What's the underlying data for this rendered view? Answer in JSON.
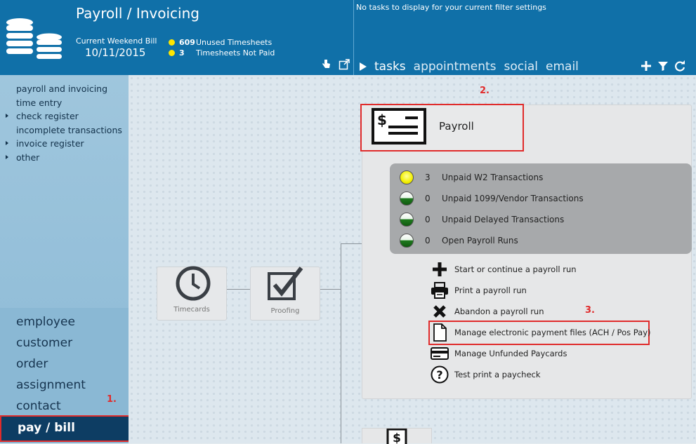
{
  "header": {
    "title": "Payroll / Invoicing",
    "bill_label": "Current Weekend Bill",
    "bill_date": "10/11/2015",
    "stats": [
      {
        "count": "609",
        "label": "Unused Timesheets"
      },
      {
        "count": "3",
        "label": "Timesheets Not Paid"
      }
    ],
    "no_tasks": "No tasks to display for your current filter settings",
    "tabs": [
      "tasks",
      "appointments",
      "social",
      "email"
    ]
  },
  "sidebar": {
    "links": [
      {
        "label": "payroll and invoicing"
      },
      {
        "label": "time entry"
      },
      {
        "label": "check register"
      },
      {
        "label": "incomplete transactions"
      },
      {
        "label": "invoice register"
      },
      {
        "label": "other"
      }
    ],
    "modules": [
      "employee",
      "customer",
      "order",
      "assignment",
      "contact"
    ],
    "active_module": "pay / bill"
  },
  "flow": {
    "timecards": "Timecards",
    "proofing": "Proofing"
  },
  "payroll": {
    "title": "Payroll",
    "statuses": [
      {
        "count": "3",
        "label": "Unpaid W2 Transactions",
        "color": "yellow"
      },
      {
        "count": "0",
        "label": "Unpaid 1099/Vendor Transactions",
        "color": "green"
      },
      {
        "count": "0",
        "label": "Unpaid Delayed Transactions",
        "color": "green"
      },
      {
        "count": "0",
        "label": "Open Payroll Runs",
        "color": "green"
      }
    ],
    "actions": [
      {
        "label": "Start or continue a payroll run",
        "icon": "plus-icon"
      },
      {
        "label": "Print a payroll run",
        "icon": "printer-icon"
      },
      {
        "label": "Abandon a payroll run",
        "icon": "x-icon"
      },
      {
        "label": "Manage electronic payment files (ACH / Pos Pay)",
        "icon": "document-icon"
      },
      {
        "label": "Manage Unfunded Paycards",
        "icon": "card-icon"
      },
      {
        "label": "Test print a paycheck",
        "icon": "question-icon"
      }
    ]
  },
  "annotations": {
    "one": "1.",
    "two": "2.",
    "three": "3."
  },
  "colors": {
    "header": "#1070a8",
    "highlight": "#e02b2b",
    "active_module": "#0d3d63"
  }
}
